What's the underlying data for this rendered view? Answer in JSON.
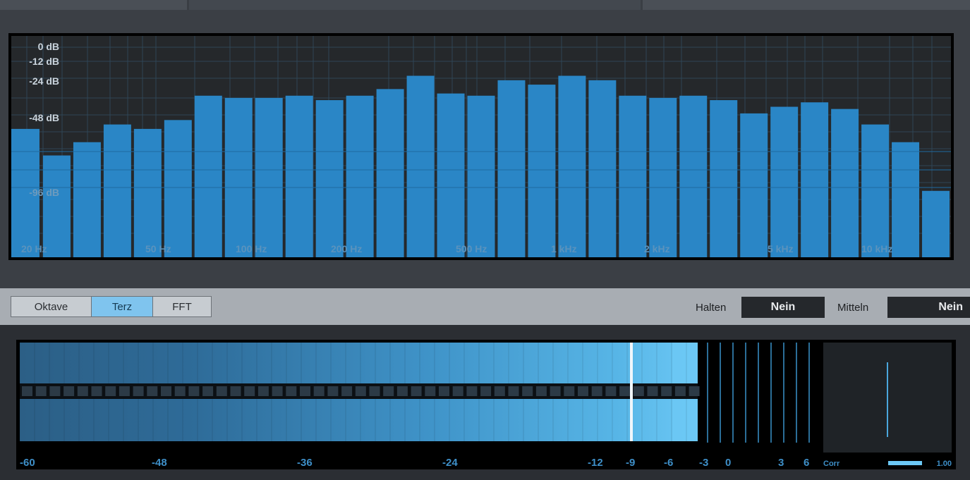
{
  "analyzer": {
    "db_labels": [
      "0 dB",
      "-12 dB",
      "-24 dB",
      "-48 dB",
      "-96 dB"
    ],
    "freq_labels": [
      "20 Hz",
      "50 Hz",
      "100 Hz",
      "200 Hz",
      "500 Hz",
      "1 kHz",
      "2 kHz",
      "5 kHz",
      "10 kHz"
    ],
    "bar_color": "#2a86c6",
    "bar_levels": [
      0.58,
      0.46,
      0.52,
      0.6,
      0.58,
      0.62,
      0.73,
      0.72,
      0.72,
      0.73,
      0.71,
      0.73,
      0.76,
      0.82,
      0.74,
      0.73,
      0.8,
      0.78,
      0.82,
      0.8,
      0.73,
      0.72,
      0.73,
      0.71,
      0.65,
      0.68,
      0.7,
      0.67,
      0.6,
      0.52,
      0.3
    ]
  },
  "modes": {
    "oktave": "Oktave",
    "terz": "Terz",
    "fft": "FFT",
    "active": "Terz"
  },
  "hold": {
    "label": "Halten",
    "value": "Nein"
  },
  "average": {
    "label": "Mitteln",
    "value": "Nein"
  },
  "level_meter": {
    "scale": [
      "-60",
      "-48",
      "-36",
      "-24",
      "-12",
      "-9",
      "-6",
      "-3",
      "0",
      "3",
      "6"
    ],
    "peak_label": "-9",
    "accent": "#6cc8f5"
  },
  "correlation": {
    "label": "Corr",
    "value": "1.00",
    "level": 1.0
  }
}
